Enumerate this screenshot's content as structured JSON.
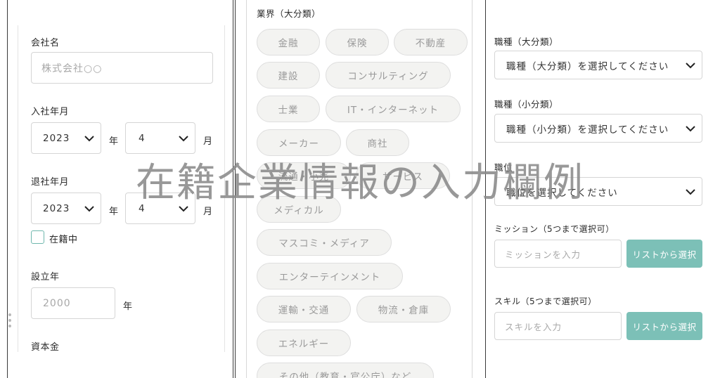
{
  "left_form": {
    "company_label": "会社名",
    "company_placeholder": "株式会社○○",
    "join_label": "入社年月",
    "join_year": "2023",
    "join_year_unit": "年",
    "join_month": "4",
    "join_month_unit": "月",
    "leave_label": "退社年月",
    "leave_year": "2023",
    "leave_year_unit": "年",
    "leave_month": "4",
    "leave_month_unit": "月",
    "current_checkbox_label": "在籍中",
    "founded_label": "設立年",
    "founded_placeholder": "2000",
    "founded_unit": "年",
    "capital_label": "資本金"
  },
  "industry": {
    "label": "業界（大分類）",
    "chips": [
      "金融",
      "保険",
      "不動産",
      "建設",
      "コンサルティング",
      "士業",
      "IT・インターネット",
      "メーカー",
      "商社",
      "流通・小売",
      "サービス",
      "メディカル",
      "マスコミ・メディア",
      "エンターテインメント",
      "運輸・交通",
      "物流・倉庫",
      "エネルギー",
      "その他（教育・官公庁）など"
    ]
  },
  "right_form": {
    "job_major_label": "職種（大分類）",
    "job_major_value": "職種（大分類）を選択してください",
    "job_minor_label": "職種（小分類）",
    "job_minor_value": "職種（小分類）を選択してください",
    "position_label": "職位",
    "position_value": "職位を選択してください",
    "mission_label": "ミッション（5つまで選択可）",
    "mission_placeholder": "ミッションを入力",
    "mission_button": "リストから選択",
    "skill_label": "スキル（5つまで選択可）",
    "skill_placeholder": "スキルを入力",
    "skill_button": "リストから選択"
  },
  "overlay_caption": "在籍企業情報の入力欄例",
  "colors": {
    "accent": "#7cc0b7",
    "chip_bg": "#f3f3f1",
    "border": "#d5d5d5"
  }
}
